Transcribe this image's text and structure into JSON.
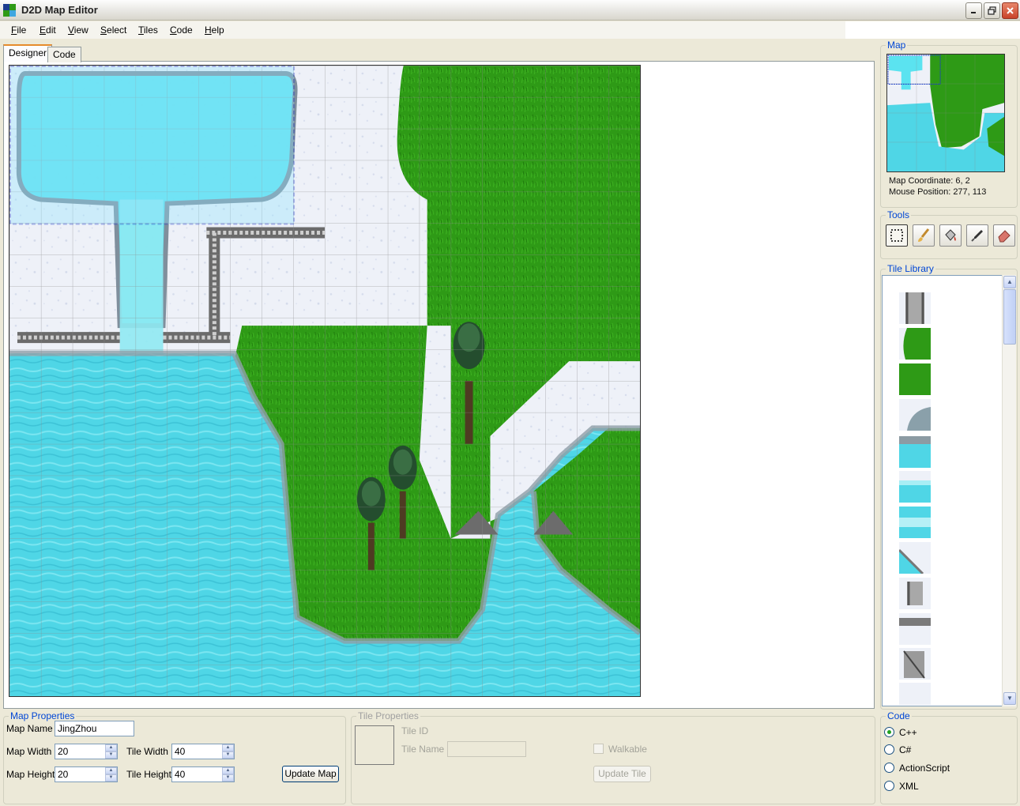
{
  "window": {
    "title": "D2D Map Editor"
  },
  "menu": [
    {
      "accel": "F",
      "rest": "ile"
    },
    {
      "accel": "E",
      "rest": "dit"
    },
    {
      "accel": "V",
      "rest": "iew"
    },
    {
      "accel": "S",
      "rest": "elect"
    },
    {
      "accel": "T",
      "rest": "iles"
    },
    {
      "accel": "C",
      "rest": "ode"
    },
    {
      "accel": "H",
      "rest": "elp"
    }
  ],
  "tabs": {
    "designer": "Designer",
    "code": "Code"
  },
  "map_panel": {
    "title": "Map",
    "coordinate": "Map Coordinate: 6, 2",
    "mouse_position": "Mouse Position: 277, 113"
  },
  "tools_panel": {
    "title": "Tools",
    "tools": [
      "selection-tool",
      "brush-tool",
      "fill-bucket-tool",
      "eyedropper-tool",
      "eraser-tool"
    ],
    "active": "selection-tool"
  },
  "tile_library": {
    "title": "Tile Library"
  },
  "map_properties": {
    "title": "Map Properties",
    "name_label": "Map Name",
    "name_value": "JingZhou",
    "width_label": "Map Width",
    "width_value": "20",
    "height_label": "Map Height",
    "height_value": "20",
    "tile_width_label": "Tile Width",
    "tile_width_value": "40",
    "tile_height_label": "Tile Height",
    "tile_height_value": "40",
    "update_button": "Update Map"
  },
  "tile_properties": {
    "title": "Tile Properties",
    "id_label": "Tile ID",
    "name_label": "Tile Name",
    "name_value": "",
    "walkable_label": "Walkable",
    "update_button": "Update Tile"
  },
  "code_panel": {
    "title": "Code",
    "options": [
      "C++",
      "C#",
      "ActionScript",
      "XML"
    ],
    "selected": "C++"
  },
  "colors": {
    "water": "#4FD6E6",
    "grass": "#2E9A16",
    "snow": "#EEF1F8",
    "selection": "#1A3BC8",
    "group_title": "#0046D5"
  }
}
